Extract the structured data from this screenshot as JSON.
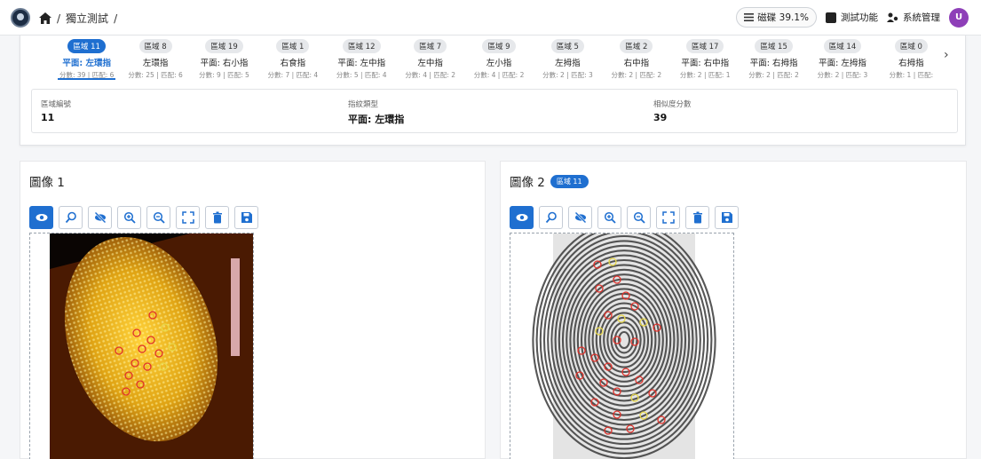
{
  "header": {
    "breadcrumb_sep1": "/",
    "breadcrumb_page": "獨立測試",
    "breadcrumb_sep2": "/",
    "progress_label": "磁碟 39.1%",
    "menu_test": "測試功能",
    "menu_admin": "系統管理",
    "avatar_letter": "U"
  },
  "regions": [
    {
      "chip": "區域 11",
      "name": "平面: 左環指",
      "stat": "分數: 39 | 匹配: 6",
      "active": true
    },
    {
      "chip": "區域 8",
      "name": "左環指",
      "stat": "分數: 25 | 匹配: 6"
    },
    {
      "chip": "區域 19",
      "name": "平面: 右小指",
      "stat": "分數: 9 | 匹配: 5"
    },
    {
      "chip": "區域 1",
      "name": "右食指",
      "stat": "分數: 7 | 匹配: 4"
    },
    {
      "chip": "區域 12",
      "name": "平面: 左中指",
      "stat": "分數: 5 | 匹配: 4"
    },
    {
      "chip": "區域 7",
      "name": "左中指",
      "stat": "分數: 4 | 匹配: 2"
    },
    {
      "chip": "區域 9",
      "name": "左小指",
      "stat": "分數: 4 | 匹配: 2"
    },
    {
      "chip": "區域 5",
      "name": "左拇指",
      "stat": "分數: 2 | 匹配: 3"
    },
    {
      "chip": "區域 2",
      "name": "右中指",
      "stat": "分數: 2 | 匹配: 2"
    },
    {
      "chip": "區域 17",
      "name": "平面: 右中指",
      "stat": "分數: 2 | 匹配: 1"
    },
    {
      "chip": "區域 15",
      "name": "平面: 右拇指",
      "stat": "分數: 2 | 匹配: 2"
    },
    {
      "chip": "區域 14",
      "name": "平面: 左拇指",
      "stat": "分數: 2 | 匹配: 3"
    },
    {
      "chip": "區域 0",
      "name": "右拇指",
      "stat": "分數: 1 | 匹配:"
    }
  ],
  "next_arrow": "›",
  "details": {
    "region_label": "區域編號",
    "region_value": "11",
    "type_label": "指紋類型",
    "type_value": "平面: 左環指",
    "score_label": "相似度分數",
    "score_value": "39"
  },
  "panel1": {
    "title": "圖像 1"
  },
  "panel2": {
    "title": "圖像 2",
    "badge": "區域 11"
  },
  "colors": {
    "accent": "#1f6fd0",
    "avatar": "#8e3fb8",
    "minutia_red": "#e0312a",
    "minutia_yellow": "#e8d84a"
  }
}
